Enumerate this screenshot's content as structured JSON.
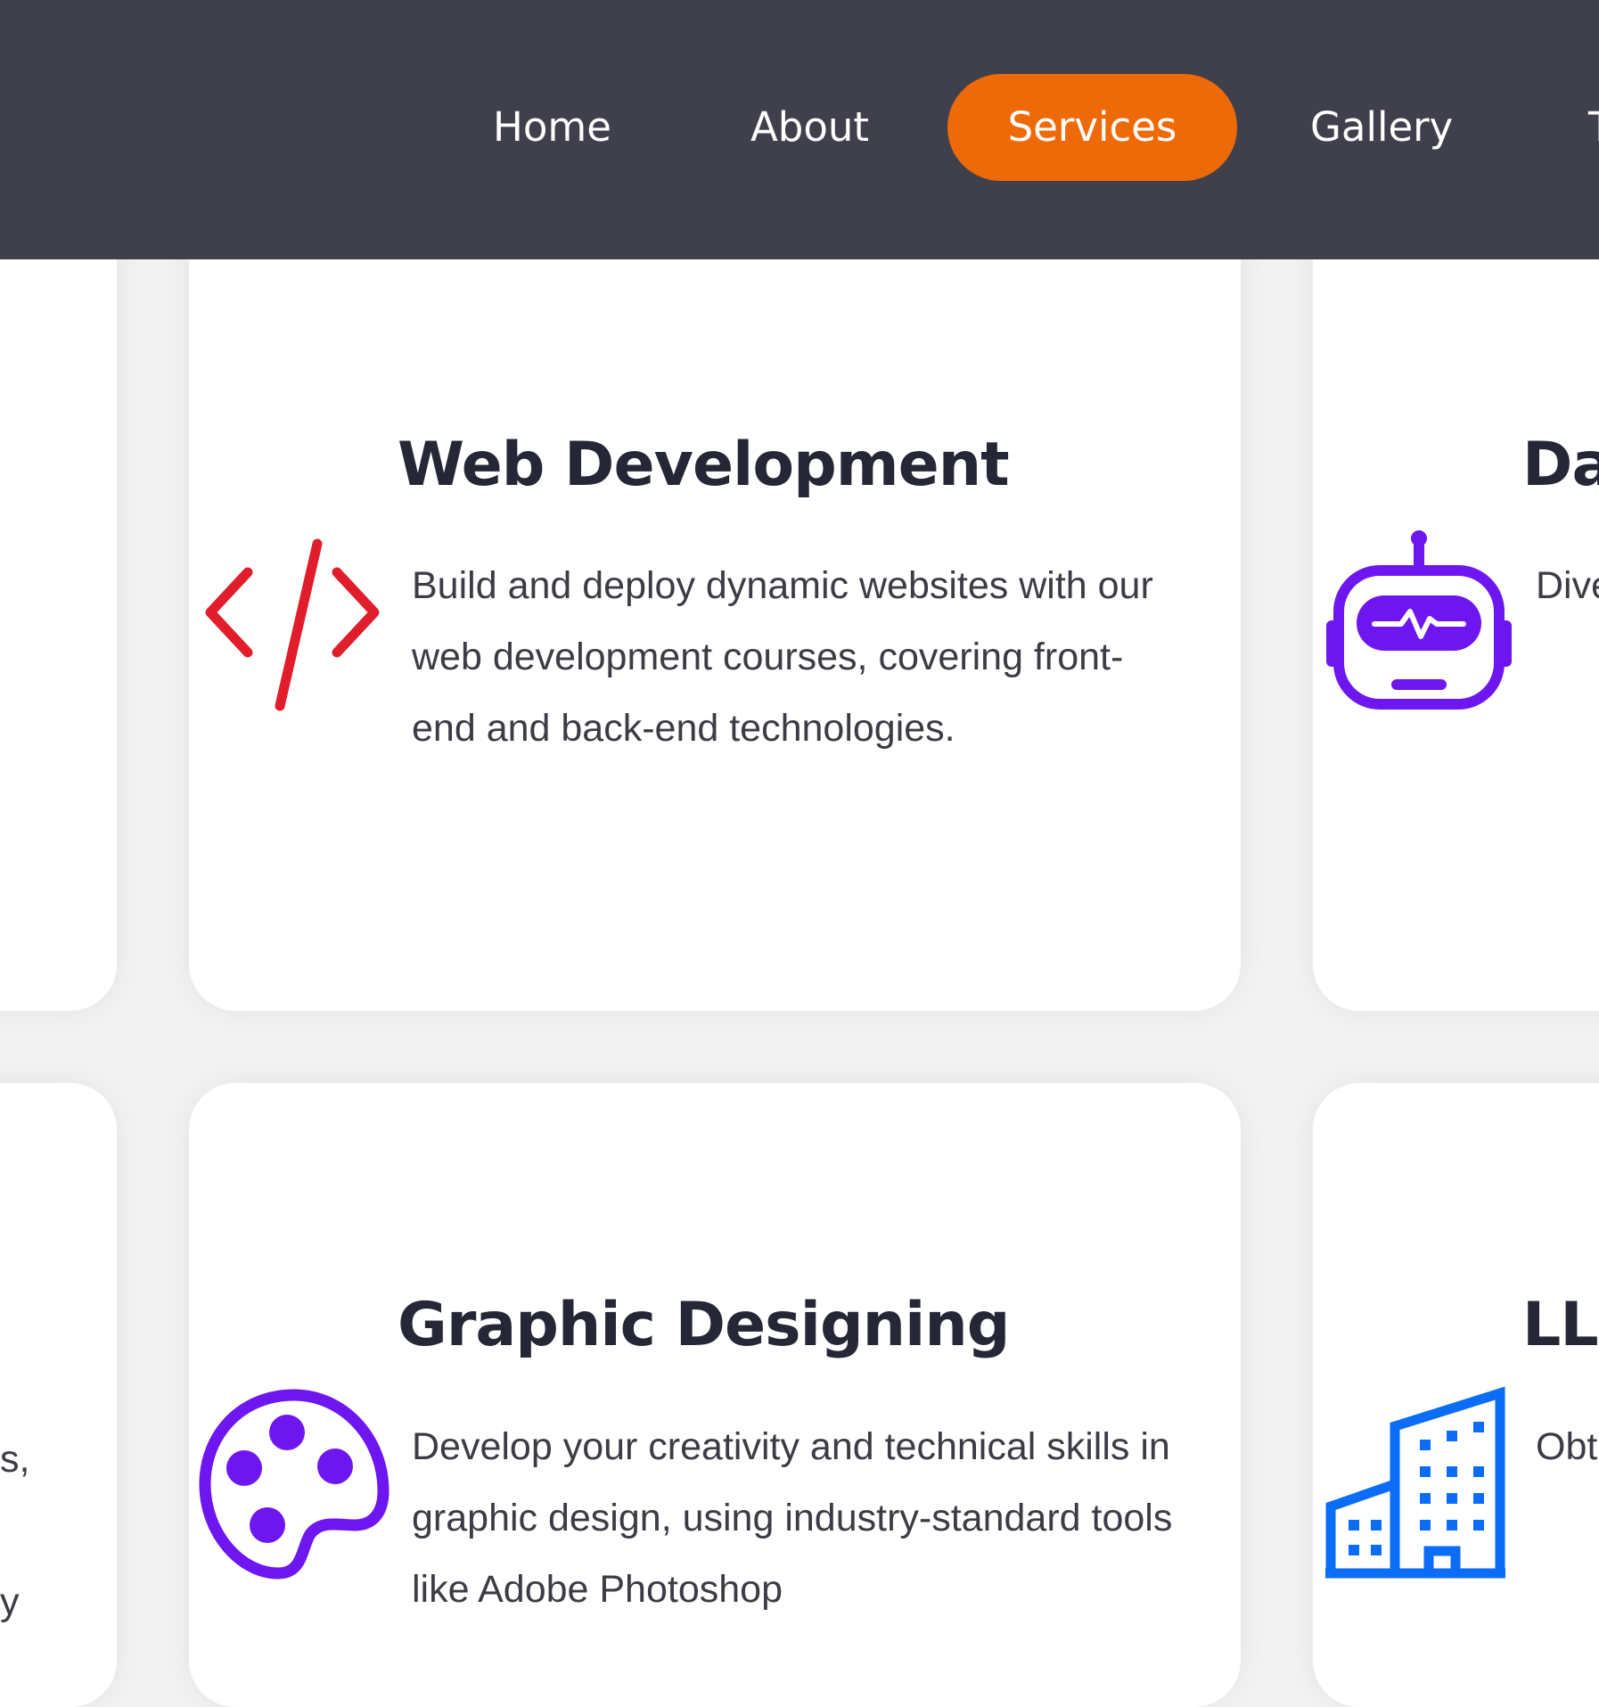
{
  "nav": {
    "items": [
      {
        "label": "Home",
        "active": false
      },
      {
        "label": "About",
        "active": false
      },
      {
        "label": "Services",
        "active": true
      },
      {
        "label": "Gallery",
        "active": false
      },
      {
        "label": "T",
        "active": false
      }
    ],
    "background": "#3f404b",
    "active_color": "#ee6a08"
  },
  "cards": {
    "web_development": {
      "title": "Web Development",
      "description": "Build and deploy dynamic websites with our web development courses, covering front-end and back-end technologies.",
      "icon": "code-icon",
      "icon_color": "#e11d2b"
    },
    "graphic_designing": {
      "title": "Graphic Designing",
      "description": "Develop your creativity and technical skills in graphic design, using industry-standard tools like Adobe Photoshop",
      "icon": "palette-icon",
      "icon_color": "#6d16f0"
    },
    "right_top": {
      "title": "Da",
      "description": "Dive han data dev",
      "icon": "robot-icon",
      "icon_color": "#6d16f0"
    },
    "right_bottom": {
      "title": "LL",
      "description": "Obt esta (LL",
      "icon": "building-icon",
      "icon_color": "#0b6cf5"
    },
    "left_bottom": {
      "fragment": "s,\n\ny"
    }
  }
}
